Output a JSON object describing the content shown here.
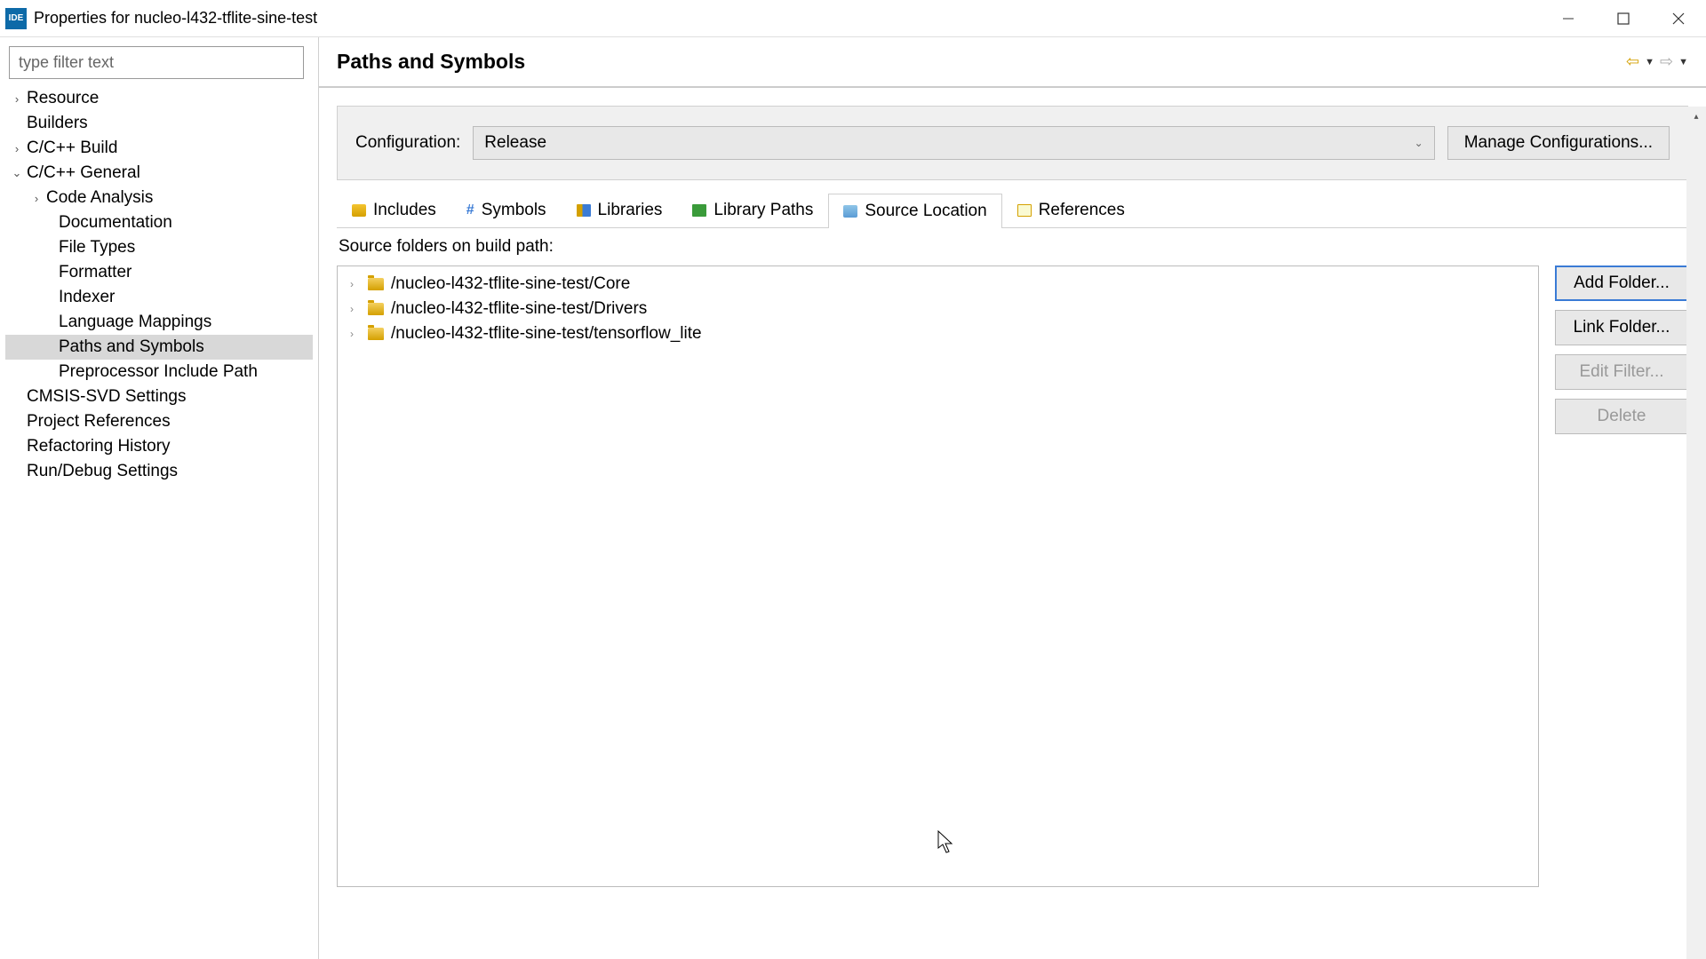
{
  "window": {
    "title": "Properties for nucleo-l432-tflite-sine-test",
    "icon_text": "IDE"
  },
  "sidebar": {
    "filter_placeholder": "type filter text",
    "items": [
      {
        "label": "Resource",
        "chevron": "›",
        "indent": 0
      },
      {
        "label": "Builders",
        "chevron": "",
        "indent": 0
      },
      {
        "label": "C/C++ Build",
        "chevron": "›",
        "indent": 0
      },
      {
        "label": "C/C++ General",
        "chevron": "⌄",
        "indent": 0
      },
      {
        "label": "Code Analysis",
        "chevron": "›",
        "indent": 1
      },
      {
        "label": "Documentation",
        "chevron": "",
        "indent": 2
      },
      {
        "label": "File Types",
        "chevron": "",
        "indent": 2
      },
      {
        "label": "Formatter",
        "chevron": "",
        "indent": 2
      },
      {
        "label": "Indexer",
        "chevron": "",
        "indent": 2
      },
      {
        "label": "Language Mappings",
        "chevron": "",
        "indent": 2
      },
      {
        "label": "Paths and Symbols",
        "chevron": "",
        "indent": 2,
        "selected": true
      },
      {
        "label": "Preprocessor Include Path",
        "chevron": "",
        "indent": 2
      },
      {
        "label": "CMSIS-SVD Settings",
        "chevron": "",
        "indent": 0
      },
      {
        "label": "Project References",
        "chevron": "",
        "indent": 0
      },
      {
        "label": "Refactoring History",
        "chevron": "",
        "indent": 0
      },
      {
        "label": "Run/Debug Settings",
        "chevron": "",
        "indent": 0
      }
    ]
  },
  "page": {
    "title": "Paths and Symbols",
    "config_label": "Configuration:",
    "config_value": "Release",
    "manage_btn": "Manage Configurations...",
    "tabs": [
      {
        "label": "Includes"
      },
      {
        "label": "Symbols"
      },
      {
        "label": "Libraries"
      },
      {
        "label": "Library Paths"
      },
      {
        "label": "Source Location"
      },
      {
        "label": "References"
      }
    ],
    "source_label": "Source folders on build path:",
    "source_folders": [
      "/nucleo-l432-tflite-sine-test/Core",
      "/nucleo-l432-tflite-sine-test/Drivers",
      "/nucleo-l432-tflite-sine-test/tensorflow_lite"
    ],
    "buttons": {
      "add": "Add Folder...",
      "link": "Link Folder...",
      "edit": "Edit Filter...",
      "delete": "Delete"
    }
  }
}
